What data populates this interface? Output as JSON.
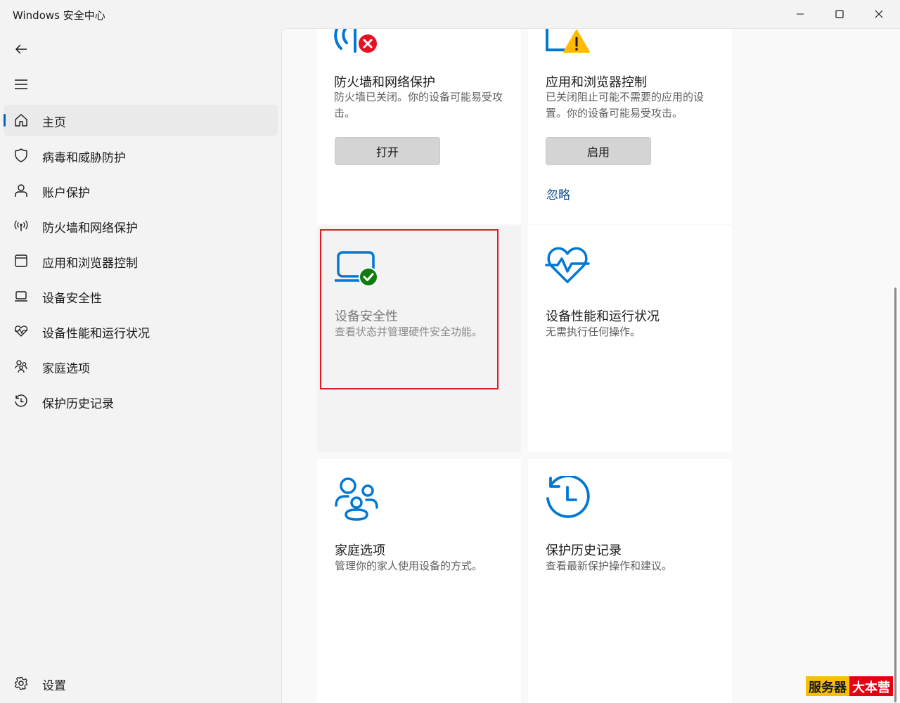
{
  "window": {
    "title": "Windows 安全中心"
  },
  "sidebar": {
    "items": [
      {
        "label": "主页",
        "icon": "home-icon"
      },
      {
        "label": "病毒和威胁防护",
        "icon": "shield-icon"
      },
      {
        "label": "账户保护",
        "icon": "person-icon"
      },
      {
        "label": "防火墙和网络保护",
        "icon": "antenna-icon"
      },
      {
        "label": "应用和浏览器控制",
        "icon": "app-window-icon"
      },
      {
        "label": "设备安全性",
        "icon": "laptop-icon"
      },
      {
        "label": "设备性能和运行状况",
        "icon": "heart-pulse-icon"
      },
      {
        "label": "家庭选项",
        "icon": "family-icon"
      },
      {
        "label": "保护历史记录",
        "icon": "history-icon"
      }
    ],
    "active_index": 0,
    "settings_label": "设置"
  },
  "cards": {
    "firewall": {
      "title": "防火墙和网络保护",
      "desc": "防火墙已关闭。你的设备可能易受攻击。",
      "button": "打开",
      "status": "error"
    },
    "app_browser": {
      "title": "应用和浏览器控制",
      "desc": "已关闭阻止可能不需要的应用的设置。你的设备可能易受攻击。",
      "button": "启用",
      "link": "忽略",
      "status": "warning"
    },
    "device_security": {
      "title": "设备安全性",
      "desc": "查看状态并管理硬件安全功能。",
      "status": "ok"
    },
    "device_health": {
      "title": "设备性能和运行状况",
      "desc": "无需执行任何操作。"
    },
    "family": {
      "title": "家庭选项",
      "desc": "管理你的家人使用设备的方式。"
    },
    "history": {
      "title": "保护历史记录",
      "desc": "查看最新保护操作和建议。"
    }
  },
  "watermark": {
    "part1": "服务器",
    "part2": "大本营"
  },
  "colors": {
    "accent": "#0067c0",
    "icon_blue": "#0078d4",
    "error": "#e81123",
    "warning": "#ffb900",
    "ok": "#107c10",
    "highlight": "#e01b24"
  }
}
